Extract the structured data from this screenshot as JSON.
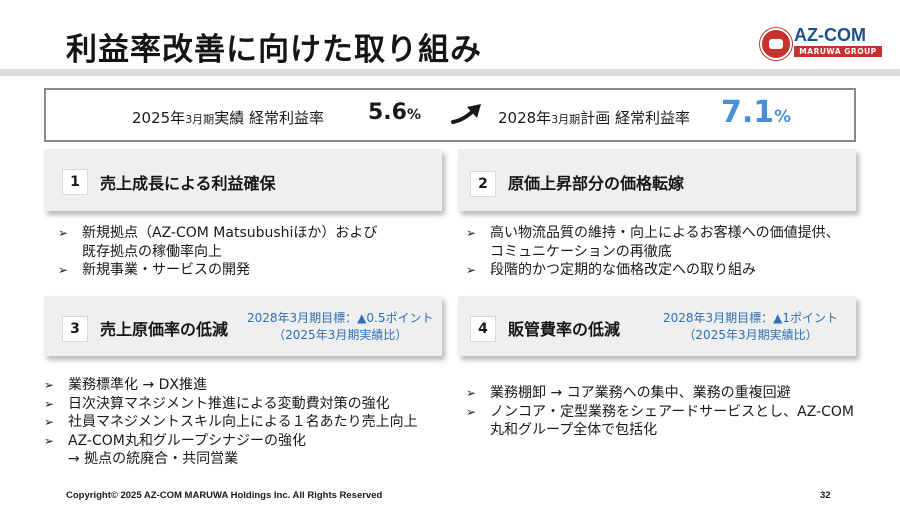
{
  "title": "利益率改善に向けた取り組み",
  "logo": {
    "name": "AZ-COM",
    "sub": "MARUWA GROUP"
  },
  "kpi": {
    "left_year": "2025年",
    "left_month": "3月期",
    "left_label": "実績 経常利益率",
    "left_value": "5.6",
    "left_unit": "%",
    "right_year": "2028年",
    "right_month": "3月期",
    "right_label": "計画 経常利益率",
    "right_value": "7.1",
    "right_unit": "%",
    "accent_color": "#4a90d6"
  },
  "boxes": [
    {
      "number": "1",
      "heading": "売上成長による利益確保"
    },
    {
      "number": "2",
      "heading": "原価上昇部分の価格転嫁"
    },
    {
      "number": "3",
      "heading": "売上原価率の低減",
      "target_line1": "2028年3月期目標：▲0.5ポイント",
      "target_line2": "（2025年3月期実績比）"
    },
    {
      "number": "4",
      "heading": "販管費率の低減",
      "target_line1": "2028年3月期目標：▲1ポイント",
      "target_line2": "（2025年3月期実績比）"
    }
  ],
  "bullets_1": [
    "新規拠点（AZ-COM Matsubushiほか）および",
    "既存拠点の稼働率向上",
    "新規事業・サービスの開発"
  ],
  "bullets_2": [
    "高い物流品質の維持・向上によるお客様への価値提供、",
    "コミュニケーションの再徹底",
    "段階的かつ定期的な価格改定への取り組み"
  ],
  "bullets_3": [
    "業務標準化 → DX推進",
    "日次決算マネジメント推進による変動費対策の強化",
    "社員マネジメントスキル向上による１名あたり売上向上",
    "AZ-COM丸和グループシナジーの強化",
    "→ 拠点の統廃合・共同営業"
  ],
  "bullets_4": [
    "業務棚卸 → コア業務への集中、業務の重複回避",
    "ノンコア・定型業務をシェアードサービスとし、AZ-COM",
    "丸和グループ全体で包括化"
  ],
  "bullet_marker": "➢",
  "footer": "Copyright© 2025 AZ-COM MARUWA Holdings Inc. All Rights Reserved",
  "page_number": "32"
}
